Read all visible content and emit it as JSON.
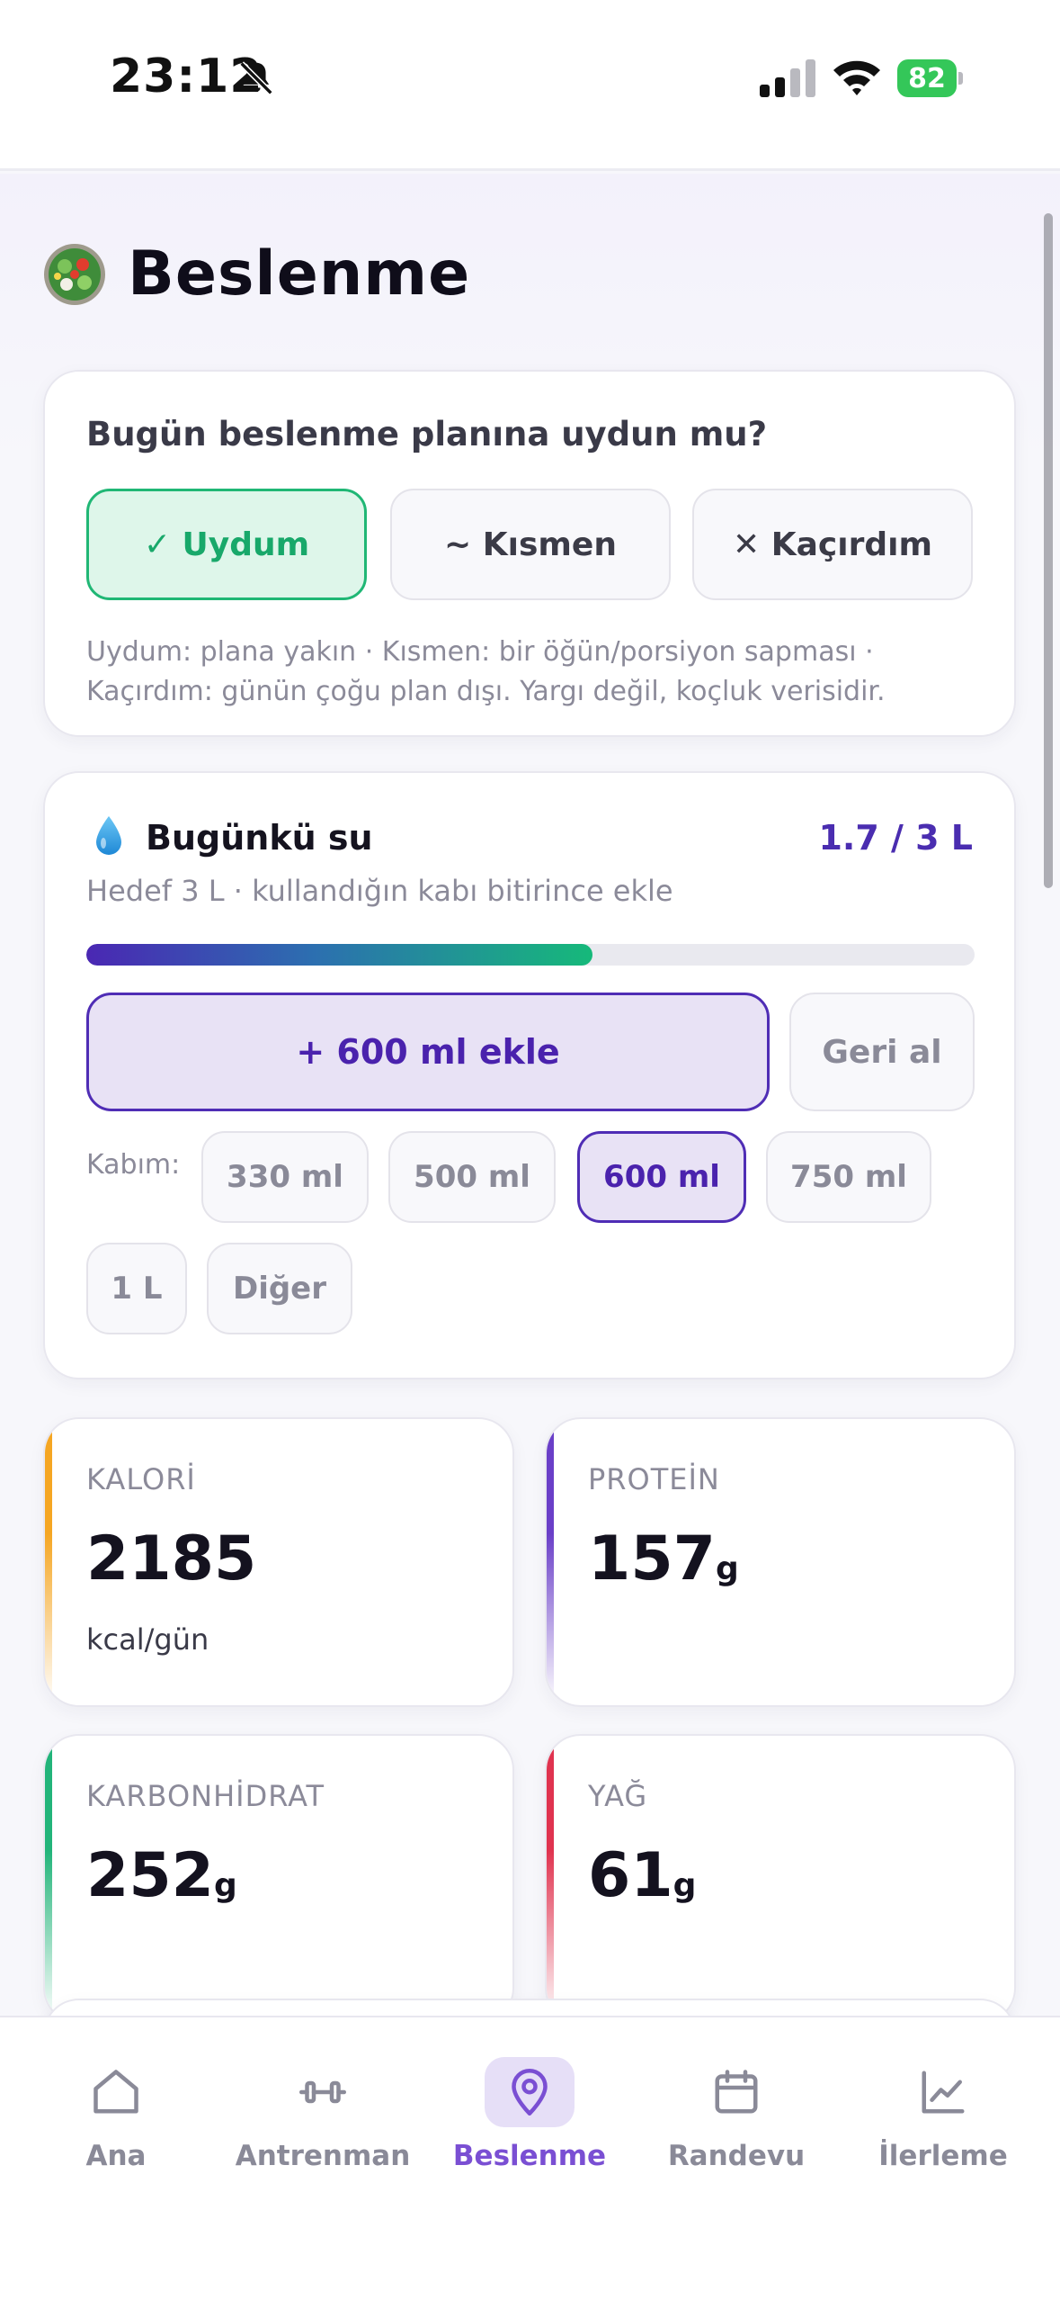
{
  "status": {
    "time": "23:12",
    "battery": "82"
  },
  "header": {
    "title": "Beslenme"
  },
  "adherence": {
    "question": "Bugün beslenme planına uydun mu?",
    "options": [
      {
        "label": "✓ Uydum",
        "selected": true
      },
      {
        "label": "~ Kısmen",
        "selected": false
      },
      {
        "label": "✕ Kaçırdım",
        "selected": false
      }
    ],
    "note": "Uydum: plana yakın · Kısmen: bir öğün/porsiyon sapması · Kaçırdım: günün çoğu plan dışı. Yargı değil, koçluk verisidir."
  },
  "water": {
    "title": "Bugünkü su",
    "amount": "1.7 / 3 L",
    "subtitle": "Hedef 3 L · kullandığın kabı bitirince ekle",
    "progress": 0.57,
    "add_label": "+ 600 ml ekle",
    "undo_label": "Geri al",
    "cup_label": "Kabım:",
    "cups": [
      {
        "label": "330 ml",
        "selected": false
      },
      {
        "label": "500 ml",
        "selected": false
      },
      {
        "label": "600 ml",
        "selected": true
      },
      {
        "label": "750 ml",
        "selected": false
      },
      {
        "label": "1 L",
        "selected": false
      },
      {
        "label": "Diğer",
        "selected": false
      }
    ]
  },
  "stats": {
    "calories": {
      "label": "KALORİ",
      "value": "2185",
      "unit": "kcal/gün",
      "color": "#f5a623"
    },
    "protein": {
      "label": "PROTEİN",
      "value": "157",
      "unit": "g",
      "color": "#6a3fc8"
    },
    "carbs": {
      "label": "KARBONHİDRAT",
      "value": "252",
      "unit": "g",
      "color": "#22b47a"
    },
    "fat": {
      "label": "YAĞ",
      "value": "61",
      "unit": "g",
      "color": "#e0334f"
    }
  },
  "nav": {
    "items": [
      {
        "label": "Ana",
        "icon": "home-icon",
        "active": false
      },
      {
        "label": "Antrenman",
        "icon": "dumbbell-icon",
        "active": false
      },
      {
        "label": "Beslenme",
        "icon": "location-pin-icon",
        "active": true
      },
      {
        "label": "Randevu",
        "icon": "calendar-icon",
        "active": false
      },
      {
        "label": "İlerleme",
        "icon": "chart-icon",
        "active": false
      }
    ]
  }
}
